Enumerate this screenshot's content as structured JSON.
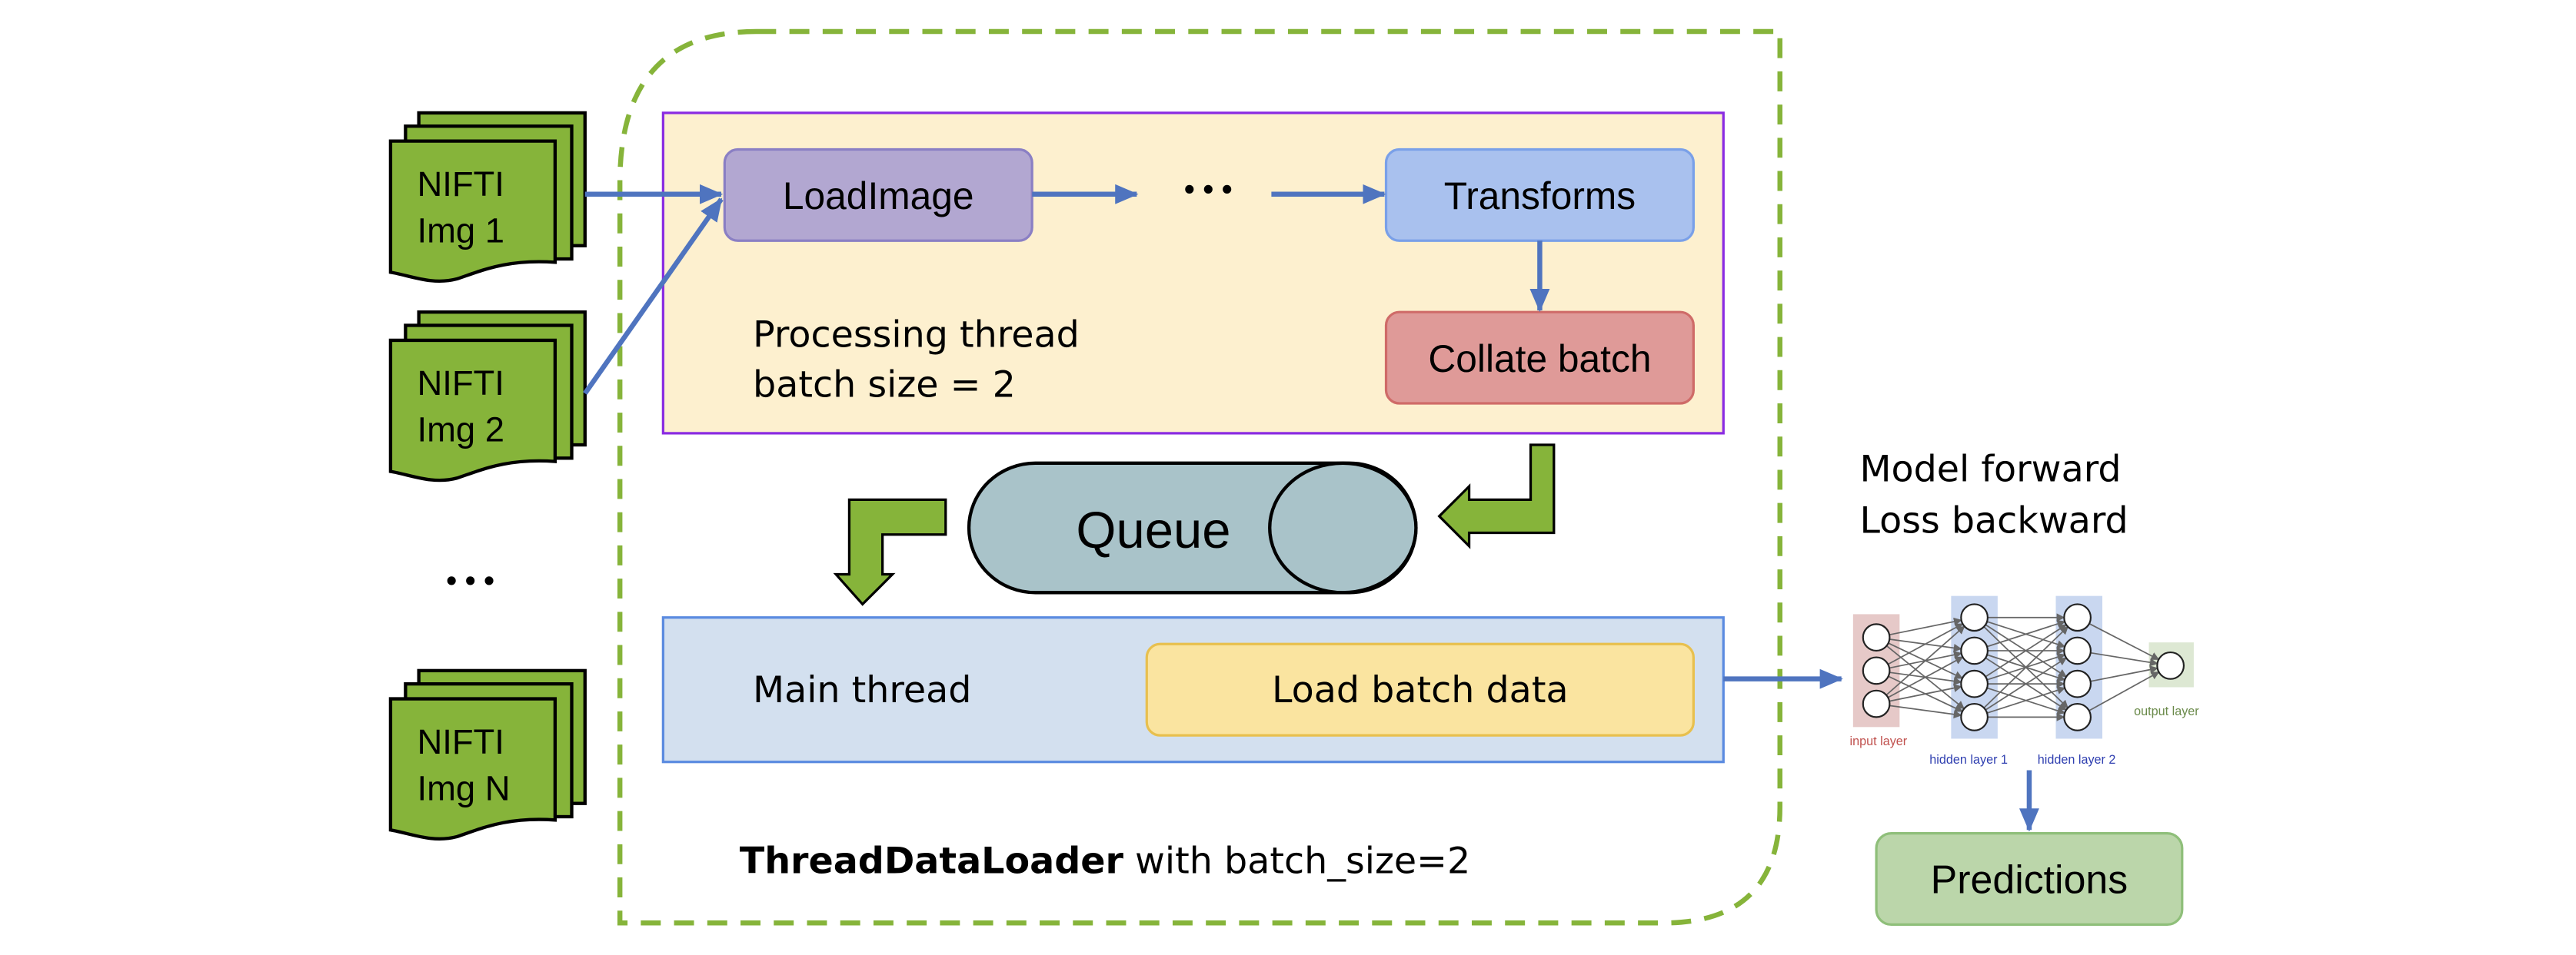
{
  "inputs": [
    {
      "line1": "NIFTI",
      "line2": "Img 1"
    },
    {
      "line1": "NIFTI",
      "line2": "Img 2"
    },
    {
      "line1": "NIFTI",
      "line2": "Img N"
    }
  ],
  "inputs_ellipsis": "• • •",
  "processing": {
    "label_line1": "Processing thread",
    "label_line2": "batch size = 2",
    "load_image": "LoadImage",
    "ellipsis": "• • •",
    "transforms": "Transforms",
    "collate": "Collate batch"
  },
  "queue": {
    "label": "Queue"
  },
  "main": {
    "label": "Main thread",
    "load_batch": "Load batch data"
  },
  "loader": {
    "name_bold": "ThreadDataLoader",
    "rest": " with batch_size=2"
  },
  "model": {
    "line1": "Model forward",
    "line2": "Loss backward",
    "layers": {
      "input": "input layer",
      "hidden1": "hidden layer 1",
      "hidden2": "hidden layer 2",
      "output": "output layer"
    },
    "predictions": "Predictions"
  },
  "colors": {
    "nifti_green": "#86b43a",
    "dashed_green": "#86b43a",
    "arrow_blue": "#4f74bf",
    "processing_fill": "#fdf0cf",
    "processing_border": "#8a2be2",
    "loadimage_fill": "#b2a7d1",
    "transforms_fill": "#a9c1ee",
    "collate_fill": "#df9a98",
    "queue_fill": "#a9c3c9",
    "main_fill": "#d3e0ef",
    "main_border": "#5b8be0",
    "loadbatch_fill": "#fae4a0",
    "predictions_fill": "#bbd6aa"
  }
}
